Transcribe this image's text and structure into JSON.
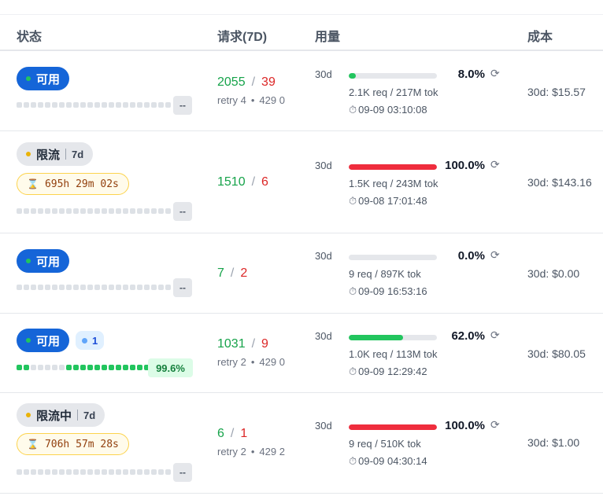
{
  "headers": {
    "status": "状态",
    "requests": "请求(7D)",
    "usage": "用量",
    "cost": "成本"
  },
  "colors": {
    "available": "#1565d8",
    "success": "#16a34a",
    "fail": "#dc2626",
    "bar_green": "#22c55e",
    "bar_red": "#ef2d3d"
  },
  "rows": [
    {
      "status": {
        "label": "可用",
        "kind": "available",
        "uptime_badge": "--"
      },
      "requests": {
        "success": "2055",
        "fail": "39",
        "retry": "retry 4",
        "r429": "429 0"
      },
      "usage": {
        "period": "30d",
        "percent": "8.0%",
        "fill_fraction": 0.08,
        "bar_color": "#22c55e",
        "req_tok": "2.1K req / 217M tok",
        "time": "09-09 03:10:08"
      },
      "cost": "30d: $15.57"
    },
    {
      "status": {
        "label": "限流",
        "kind": "limited",
        "window": "7d",
        "timer": "695h 29m 02s",
        "uptime_badge": "--"
      },
      "requests": {
        "success": "1510",
        "fail": "6"
      },
      "usage": {
        "period": "30d",
        "percent": "100.0%",
        "fill_fraction": 1.0,
        "bar_color": "#ef2d3d",
        "req_tok": "1.5K req / 243M tok",
        "time": "09-08 17:01:48"
      },
      "cost": "30d: $143.16"
    },
    {
      "status": {
        "label": "可用",
        "kind": "available",
        "uptime_badge": "--"
      },
      "requests": {
        "success": "7",
        "fail": "2"
      },
      "usage": {
        "period": "30d",
        "percent": "0.0%",
        "fill_fraction": 0.0,
        "bar_color": "#22c55e",
        "req_tok": "9 req / 897K tok",
        "time": "09-09 16:53:16"
      },
      "cost": "30d: $0.00"
    },
    {
      "status": {
        "label": "可用",
        "kind": "available",
        "sub_count": "1",
        "uptime_badge": "99.6%"
      },
      "requests": {
        "success": "1031",
        "fail": "9",
        "retry": "retry 2",
        "r429": "429 0"
      },
      "usage": {
        "period": "30d",
        "percent": "62.0%",
        "fill_fraction": 0.62,
        "bar_color": "#22c55e",
        "req_tok": "1.0K req / 113M tok",
        "time": "09-09 12:29:42"
      },
      "cost": "30d: $80.05"
    },
    {
      "status": {
        "label": "限流中",
        "kind": "limited",
        "window": "7d",
        "timer": "706h 57m 28s",
        "uptime_badge": "--"
      },
      "requests": {
        "success": "6",
        "fail": "1",
        "retry": "retry 2",
        "r429": "429 2"
      },
      "usage": {
        "period": "30d",
        "percent": "100.0%",
        "fill_fraction": 1.0,
        "bar_color": "#ef2d3d",
        "req_tok": "9 req / 510K tok",
        "time": "09-09 04:30:14"
      },
      "cost": "30d: $1.00"
    }
  ]
}
